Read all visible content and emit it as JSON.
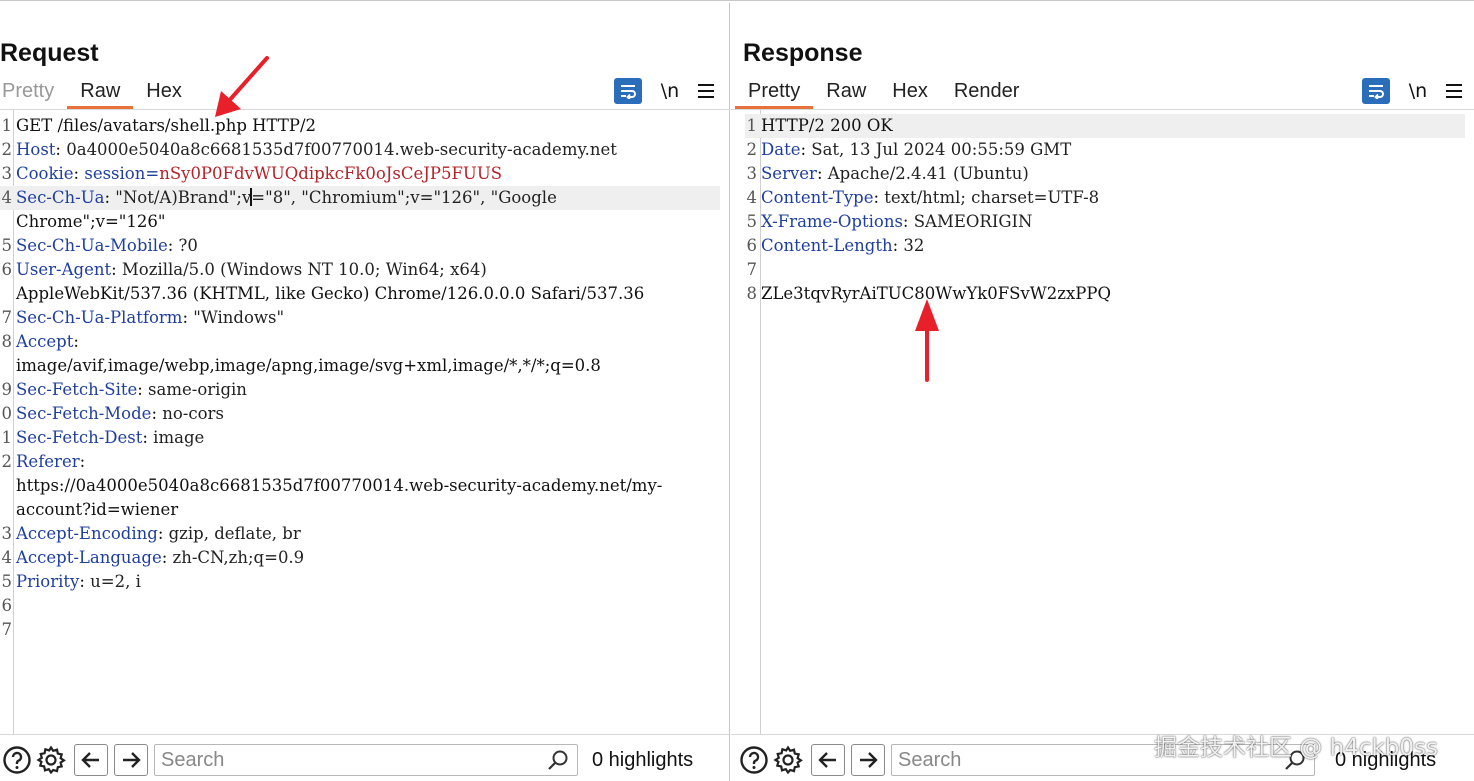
{
  "layout_toggle": {
    "options": [
      "side-by-side-layout-icon",
      "stacked-layout-icon",
      "single-pane-layout-icon"
    ],
    "active": 0,
    "accent": "#2a6ebb"
  },
  "request": {
    "title": "Request",
    "tabs": [
      "Pretty",
      "Raw",
      "Hex"
    ],
    "active_tab": "Raw",
    "tools": {
      "newline_label": "\\n"
    },
    "lines": [
      {
        "num": "1",
        "text": "GET /files/avatars/shell.php HTTP/2"
      },
      {
        "num": "2",
        "name": "Host",
        "value": " 0a4000e5040a8c6681535d7f00770014.web-security-academy.net"
      },
      {
        "num": "3",
        "name": "Cookie",
        "value": " session=",
        "cookie": "nSy0P0FdvWUQdipkcFk0oJsCeJP5FUUS"
      },
      {
        "num": "4",
        "name": "Sec-Ch-Ua",
        "value_a": " \"Not/A)Brand\";v",
        "value_b": "=\"8\", \"Chromium\";v=\"126\", \"Google",
        "cont": "Chrome\";v=\"126\""
      },
      {
        "num": "5",
        "name": "Sec-Ch-Ua-Mobile",
        "value": " ?0"
      },
      {
        "num": "6",
        "name": "User-Agent",
        "value": " Mozilla/5.0 (Windows NT 10.0; Win64; x64)",
        "cont": "AppleWebKit/537.36 (KHTML, like Gecko) Chrome/126.0.0.0 Safari/537.36"
      },
      {
        "num": "7",
        "name": "Sec-Ch-Ua-Platform",
        "value": " \"Windows\""
      },
      {
        "num": "8",
        "name": "Accept",
        "value": "",
        "cont": "image/avif,image/webp,image/apng,image/svg+xml,image/*,*/*;q=0.8"
      },
      {
        "num": "9",
        "name": "Sec-Fetch-Site",
        "value": " same-origin"
      },
      {
        "num": "0",
        "name": "Sec-Fetch-Mode",
        "value": " no-cors"
      },
      {
        "num": "1",
        "name": "Sec-Fetch-Dest",
        "value": " image"
      },
      {
        "num": "2",
        "name": "Referer",
        "value": "",
        "cont": "https://0a4000e5040a8c6681535d7f00770014.web-security-academy.net/my-",
        "cont2": "account?id=wiener"
      },
      {
        "num": "3",
        "name": "Accept-Encoding",
        "value": " gzip, deflate, br"
      },
      {
        "num": "4",
        "name": "Accept-Language",
        "value": " zh-CN,zh;q=0.9"
      },
      {
        "num": "5",
        "name": "Priority",
        "value": " u=2, i"
      },
      {
        "num": "6",
        "text": ""
      },
      {
        "num": "7",
        "text": ""
      }
    ],
    "search": {
      "placeholder": "Search",
      "value": ""
    },
    "highlights": "0 highlights"
  },
  "response": {
    "title": "Response",
    "tabs": [
      "Pretty",
      "Raw",
      "Hex",
      "Render"
    ],
    "active_tab": "Pretty",
    "tools": {
      "newline_label": "\\n"
    },
    "lines": [
      {
        "num": "1",
        "text": "HTTP/2 200 OK"
      },
      {
        "num": "2",
        "name": "Date",
        "value": " Sat, 13 Jul 2024 00:55:59 GMT"
      },
      {
        "num": "3",
        "name": "Server",
        "value": " Apache/2.4.41 (Ubuntu)"
      },
      {
        "num": "4",
        "name": "Content-Type",
        "value": " text/html; charset=UTF-8"
      },
      {
        "num": "5",
        "name": "X-Frame-Options",
        "value": " SAMEORIGIN"
      },
      {
        "num": "6",
        "name": "Content-Length",
        "value": " 32"
      },
      {
        "num": "7",
        "text": ""
      },
      {
        "num": "8",
        "text": "ZLe3tqvRyrAiTUC80WwYk0FSvW2zxPPQ"
      }
    ],
    "search": {
      "placeholder": "Search",
      "value": ""
    },
    "highlights": "0 highlights"
  },
  "colors": {
    "header_name": "#1f3f9e",
    "cookie_value": "#b5232a",
    "annotation_arrow": "#e8202a",
    "active_tab_underline": "#e8703a"
  },
  "watermark": "掘金技术社区 @ h4ckb0ss"
}
